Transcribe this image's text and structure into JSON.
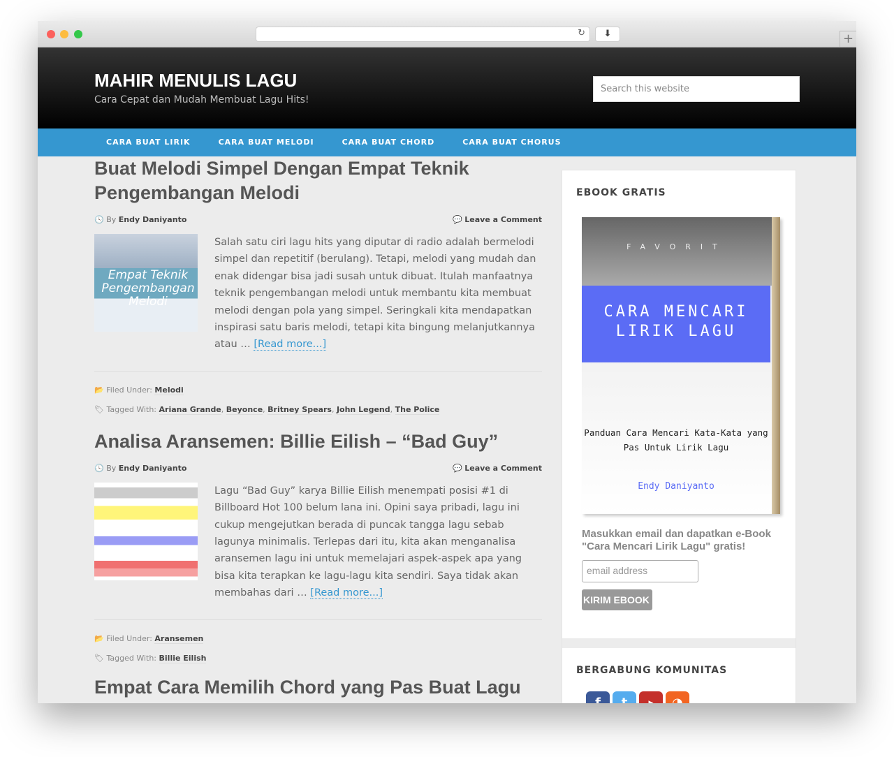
{
  "site": {
    "title": "MAHIR MENULIS LAGU",
    "tagline": "Cara Cepat dan Mudah Membuat Lagu Hits!",
    "search_placeholder": "Search this website"
  },
  "nav": [
    "CARA BUAT LIRIK",
    "CARA BUAT MELODI",
    "CARA BUAT CHORD",
    "CARA BUAT CHORUS"
  ],
  "posts": [
    {
      "title": "Buat Melodi Simpel Dengan Empat Teknik Pengembangan Melodi",
      "by": "By",
      "author": "Endy Daniyanto",
      "comment": "Leave a Comment",
      "thumb_text": "Empat Teknik Pengembangan Melodi",
      "excerpt": "Salah satu ciri lagu hits yang diputar di radio adalah bermelodi simpel dan repetitif (berulang). Tetapi, melodi yang mudah dan enak didengar bisa jadi susah untuk dibuat. Itulah manfaatnya teknik pengembangan melodi untuk membantu kita membuat melodi dengan pola yang simpel. Seringkali kita mendapatkan inspirasi satu baris melodi, tetapi kita bingung melanjutkannya atau … ",
      "read_more": "[Read more...]",
      "filed_label": "Filed Under:",
      "category": "Melodi",
      "tagged_label": "Tagged With:",
      "tags": [
        "Ariana Grande",
        "Beyonce",
        "Britney Spears",
        "John Legend",
        "The Police"
      ]
    },
    {
      "title": "Analisa Aransemen: Billie Eilish – “Bad Guy”",
      "by": "By",
      "author": "Endy Daniyanto",
      "comment": "Leave a Comment",
      "excerpt": "Lagu “Bad Guy” karya Billie Eilish menempati posisi #1 di Billboard Hot 100 belum lana ini. Opini saya pribadi, lagu ini cukup mengejutkan berada di puncak tangga lagu sebab lagunya minimalis. Terlepas dari itu, kita akan menganalisa aransemen lagu ini untuk memelajari aspek-aspek apa yang bisa kita terapkan ke lagu-lagu kita sendiri. Saya tidak akan membahas dari … ",
      "read_more": "[Read more...]",
      "filed_label": "Filed Under:",
      "category": "Aransemen",
      "tagged_label": "Tagged With:",
      "tags": [
        "Billie Eilish"
      ]
    },
    {
      "title": "Empat Cara Memilih Chord yang Pas Buat Lagu"
    }
  ],
  "sidebar": {
    "ebook_title": "EBOOK GRATIS",
    "book_title": "CARA MENCARI LIRIK LAGU",
    "book_sub": "Panduan Cara Mencari Kata-Kata yang Pas Untuk Lirik Lagu",
    "book_author": "Endy Daniyanto",
    "book_brand": "FAVORIT",
    "promo": "Masukkan email dan dapatkan e-Book \"Cara Mencari Lirik Lagu\" gratis!",
    "email_placeholder": "email address",
    "submit": "KIRIM EBOOK",
    "community_title": "BERGABUNG KOMUNITAS"
  },
  "colors": {
    "accent": "#3597d0",
    "book_band": "#5b6cf5"
  }
}
